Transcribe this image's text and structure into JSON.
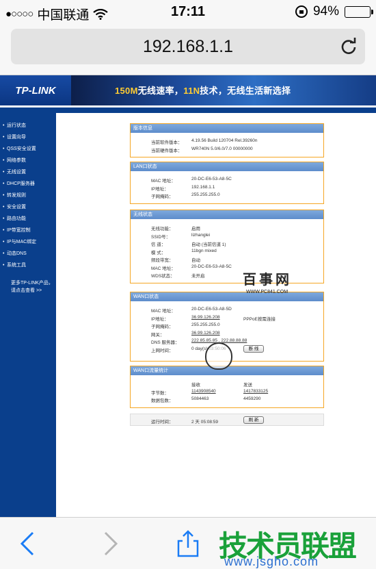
{
  "statusbar": {
    "carrier": "中国联通",
    "signal_dots": "●○○○○",
    "time": "17:11",
    "battery": "94%"
  },
  "address": {
    "url": "192.168.1.1"
  },
  "router": {
    "logo": "TP-LINK",
    "slogan": {
      "p1": "150M",
      "p2": "无线速率，",
      "p3": "11N",
      "p4": "技术，无线生活新选择"
    },
    "nav": [
      "运行状态",
      "设置向导",
      "QSS安全设置",
      "网络参数",
      "无线设置",
      "DHCP服务器",
      "转发规则",
      "安全设置",
      "路由功能",
      "IP带宽控制",
      "IP与MAC绑定",
      "动态DNS",
      "系统工具"
    ],
    "more_line1": "更多TP-LINK产品，",
    "more_line2": "请点击查看 >>",
    "version": {
      "title": "版本信息",
      "rows": [
        {
          "k": "当前软件版本：",
          "v": "4.19.56 Build 120704 Rel.39260n"
        },
        {
          "k": "当前硬件版本：",
          "v": "WR740N 5.0/6.0/7.0 00000000"
        }
      ]
    },
    "lan": {
      "title": "LAN口状态",
      "rows": [
        {
          "k": "MAC 地址：",
          "v": "20-DC-E6-53-A8-5C"
        },
        {
          "k": "IP地址：",
          "v": "192.168.1.1"
        },
        {
          "k": "子网掩码：",
          "v": "255.255.255.0"
        }
      ]
    },
    "wireless": {
      "title": "无线状态",
      "rows": [
        {
          "k": "无线功能：",
          "v": "启用"
        },
        {
          "k": "SSID号：",
          "v": "lizhanglei"
        },
        {
          "k": "信 道：",
          "v": "自动 (当前信道 1)"
        },
        {
          "k": "模 式：",
          "v": "11bgn mixed"
        },
        {
          "k": "频段带宽：",
          "v": "自动"
        },
        {
          "k": "MAC 地址：",
          "v": "20-DC-E6-53-A8-5C"
        },
        {
          "k": "WDS状态：",
          "v": "未开启"
        }
      ]
    },
    "wan": {
      "title": "WAN口状态",
      "mac_k": "MAC 地址：",
      "mac_v": "20-DC-E6-53-A8-5D",
      "ip_k": "IP地址：",
      "ip_v": "36.99.126.208",
      "ip_type": "PPPoE按需连接",
      "mask_k": "子网掩码：",
      "mask_v": "255.255.255.0",
      "gw_k": "网关：",
      "gw_v": "36.99.126.208",
      "dns_k": "DNS 服务器：",
      "dns_v": "222.85.85.85 , 222.88.88.88",
      "uptime_k": "上网时间：",
      "uptime_v": "0 day(s) 03:50:06",
      "disconnect": "断 线"
    },
    "traffic": {
      "title": "WAN口流量统计",
      "col_recv": "接收",
      "col_send": "发送",
      "bytes_k": "字节数：",
      "bytes_recv": "1143908540",
      "bytes_send": "1417833125",
      "pkts_k": "数据包数：",
      "pkts_recv": "5084463",
      "pkts_send": "4459290"
    },
    "runtime": {
      "k": "运行时间：",
      "v": "2 天 05:08:59",
      "refresh": "刷 新"
    }
  },
  "watermark": {
    "main": "百事网",
    "sub": "WWW.PC841.COM"
  },
  "toolbar_watermark": {
    "main": "技术员联盟",
    "sub": "www.jsgho.com"
  }
}
